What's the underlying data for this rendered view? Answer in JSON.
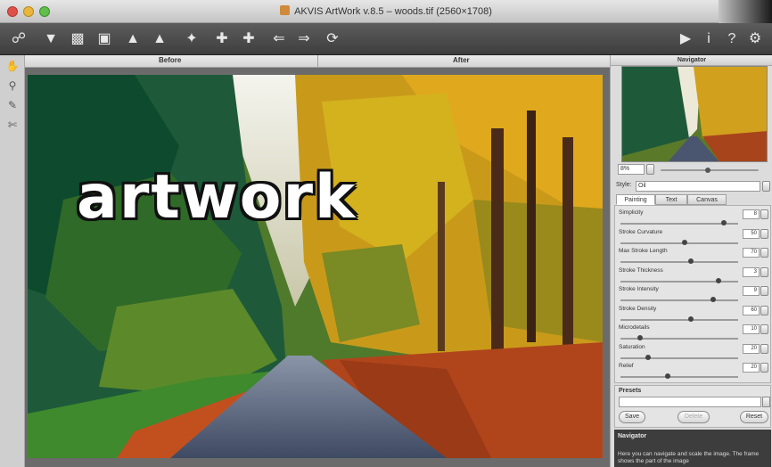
{
  "window": {
    "title": "AKVIS ArtWork v.8.5 – woods.tif (2560×1708)"
  },
  "toolbar": {
    "left_icons": [
      "open-icon",
      "save-icon",
      "print-icon",
      "share-icon",
      "stamp-icon",
      "import-icon",
      "export-icon",
      "settings-icon",
      "undo-icon",
      "redo-icon",
      "reset-icon"
    ],
    "right_icons": [
      "run-icon",
      "info-icon",
      "help-icon",
      "gear-icon"
    ]
  },
  "left_tools": [
    "hand-tool-icon",
    "zoom-tool-icon",
    "brush-tool-icon",
    "eraser-tool-icon"
  ],
  "view_tabs": {
    "before": "Before",
    "after": "After"
  },
  "overlay_text": "artwork",
  "navigator": {
    "title": "Navigator",
    "zoom": "8%"
  },
  "style": {
    "label": "Style:",
    "value": "Oil"
  },
  "settings_tabs": [
    "Painting",
    "Text",
    "Canvas"
  ],
  "parameters": [
    {
      "label": "Simplicity",
      "value": "8",
      "level": 0.9
    },
    {
      "label": "Stroke Curvature",
      "value": "50",
      "level": 0.55
    },
    {
      "label": "Max Stroke Length",
      "value": "70",
      "level": 0.6
    },
    {
      "label": "Stroke Thickness",
      "value": "3",
      "level": 0.85
    },
    {
      "label": "Stroke Intensity",
      "value": "9",
      "level": 0.8
    },
    {
      "label": "Stroke Density",
      "value": "60",
      "level": 0.6
    },
    {
      "label": "Microdetails",
      "value": "10",
      "level": 0.15
    },
    {
      "label": "Saturation",
      "value": "20",
      "level": 0.22
    },
    {
      "label": "Relief",
      "value": "20",
      "level": 0.4
    }
  ],
  "presets": {
    "label": "Presets",
    "buttons": [
      "Save",
      "Delete",
      "Reset"
    ]
  },
  "help_panel": {
    "title": "Navigator",
    "text": "Here you can navigate and scale the image. The frame shows the part of the image"
  },
  "colors": {
    "toolbar_bg": "#4a4a4a",
    "panel_bg": "#dcdcdc",
    "help_bg": "#3d3d3d"
  }
}
